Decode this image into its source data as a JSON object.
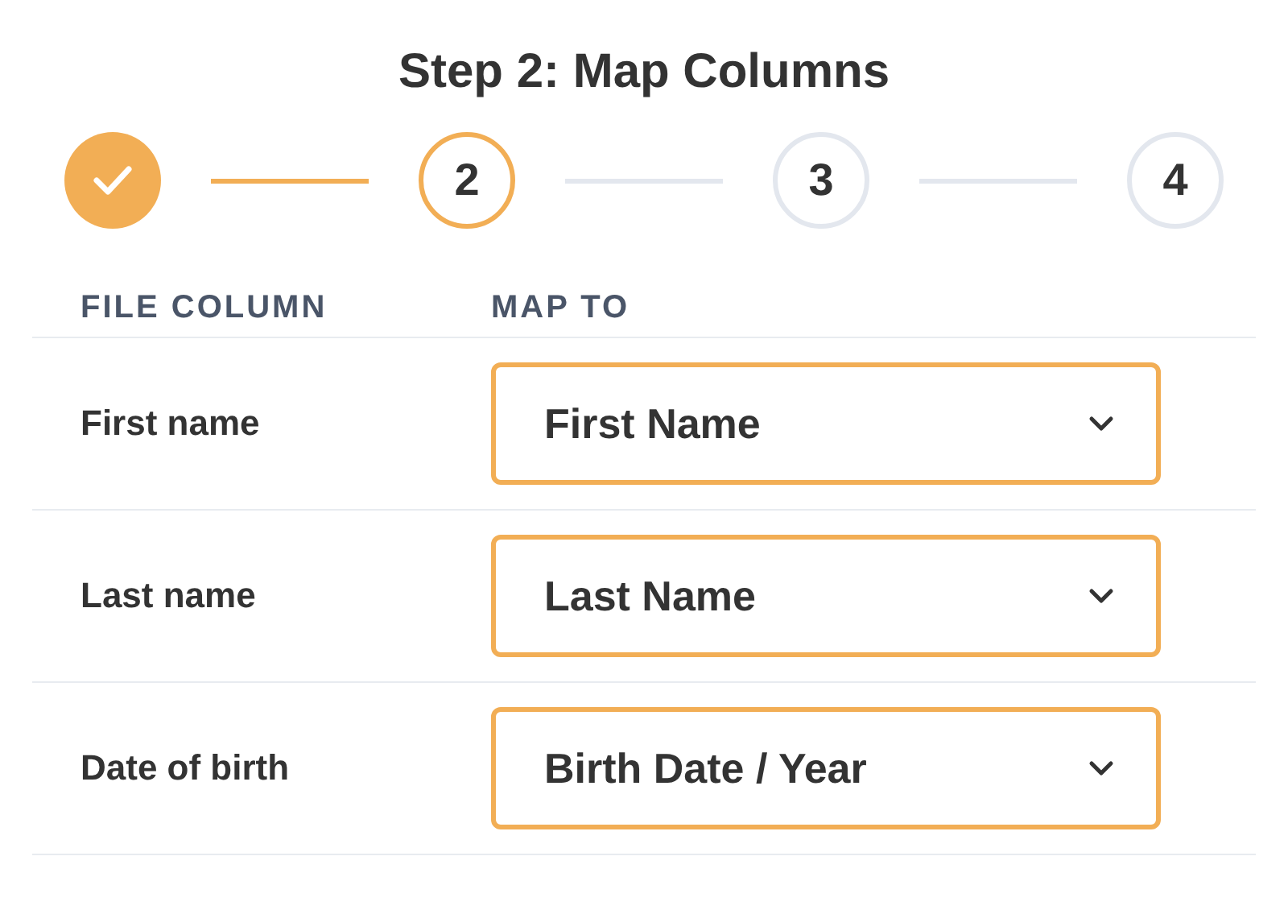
{
  "title": "Step 2: Map Columns",
  "steps": [
    {
      "kind": "done"
    },
    {
      "label": "2",
      "kind": "current"
    },
    {
      "label": "3",
      "kind": "upcoming"
    },
    {
      "label": "4",
      "kind": "upcoming"
    }
  ],
  "table": {
    "columns": [
      "FILE COLUMN",
      "MAP TO"
    ],
    "rows": [
      {
        "file_column": "First name",
        "map_to": "First Name"
      },
      {
        "file_column": "Last name",
        "map_to": "Last Name"
      },
      {
        "file_column": "Date of birth",
        "map_to": "Birth Date / Year"
      }
    ]
  }
}
